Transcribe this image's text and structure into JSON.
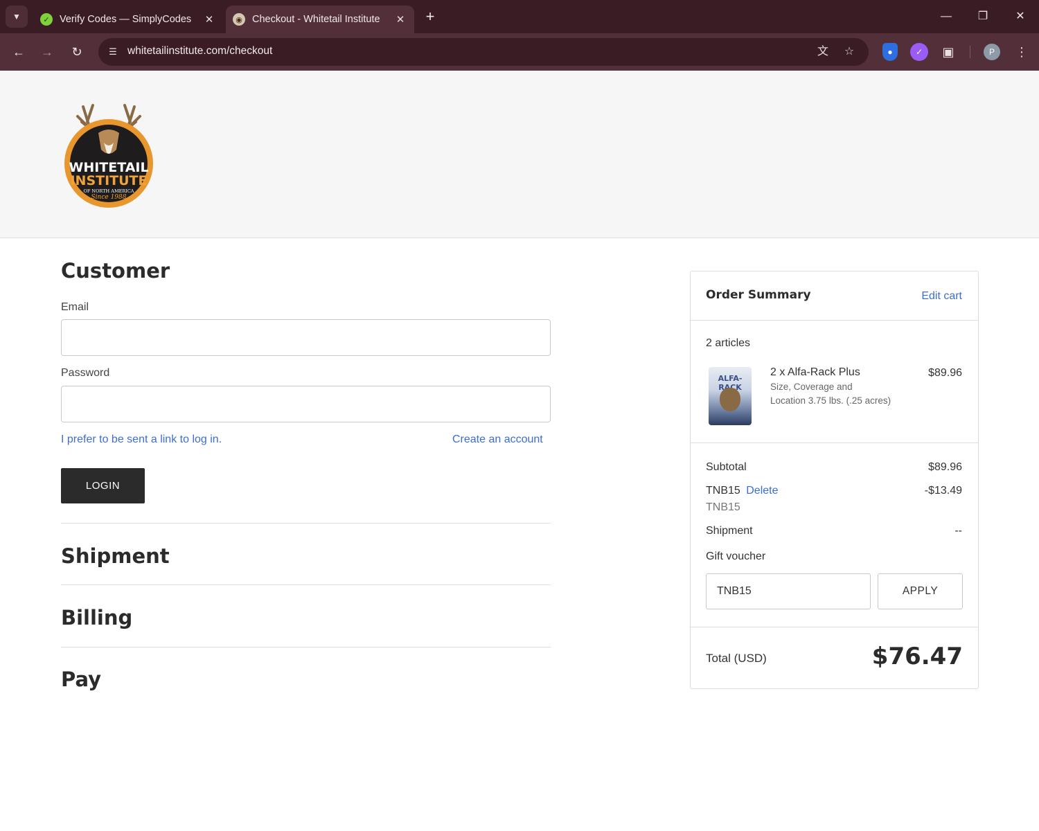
{
  "browser": {
    "tabs": [
      {
        "title": "Verify Codes — SimplyCodes",
        "active": false
      },
      {
        "title": "Checkout - Whitetail Institute",
        "active": true
      }
    ],
    "url": "whitetailinstitute.com/checkout",
    "profile_initial": "P"
  },
  "logo": {
    "line1": "WHITETAIL",
    "line2": "INSTITUTE",
    "line3": "OF NORTH AMERICA",
    "line4": "Since 1988"
  },
  "customer": {
    "heading": "Customer",
    "email_label": "Email",
    "email_value": "",
    "password_label": "Password",
    "password_value": "",
    "link_login": "I prefer to be sent a link to log in.",
    "link_create": "Create an account",
    "login_button": "LOGIN"
  },
  "sections": {
    "shipment": "Shipment",
    "billing": "Billing",
    "pay": "Pay"
  },
  "summary": {
    "title": "Order Summary",
    "edit_cart": "Edit cart",
    "articles": "2 articles",
    "item": {
      "name": "2 x Alfa-Rack Plus",
      "detail_line1": "Size, Coverage and",
      "detail_line2": "Location 3.75 lbs. (.25 acres)",
      "price": "$89.96",
      "image_brand": "ALFA-RACK"
    },
    "subtotal_label": "Subtotal",
    "subtotal_value": "$89.96",
    "coupon_code": "TNB15",
    "coupon_delete": "Delete",
    "coupon_value": "-$13.49",
    "coupon_sub": "TNB15",
    "shipment_label": "Shipment",
    "shipment_value": "--",
    "voucher_label": "Gift voucher",
    "voucher_value": "TNB15",
    "apply_button": "APPLY",
    "total_label": "Total (USD)",
    "total_value": "$76.47"
  },
  "colors": {
    "chrome_dark": "#3a1c24",
    "chrome_toolbar": "#532f39",
    "link": "#3b6ed1",
    "button_dark": "#2b2b2b"
  },
  "icons": [
    "tab-search-icon",
    "close-icon",
    "plus-icon",
    "back-icon",
    "forward-icon",
    "reload-icon",
    "site-info-icon",
    "translate-icon",
    "star-icon",
    "bitwarden-icon",
    "simplycodes-icon",
    "puzzle-icon",
    "kebab-icon"
  ]
}
